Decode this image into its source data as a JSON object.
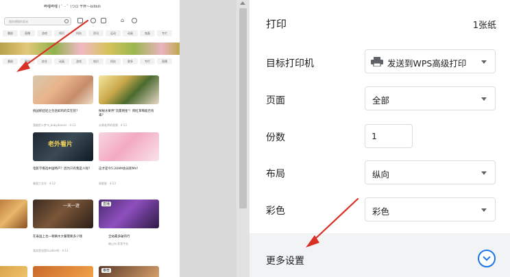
{
  "preview": {
    "page_header": "哔哩哔哩 ( ゜- ゜)つロ 干杯~-bilibili",
    "search_placeholder": "搜你想搜的发米",
    "tabs_row1": [
      "番剧",
      "直播",
      "游戏",
      "知识",
      "科技",
      "资讯",
      "运动",
      "动画",
      "鬼畜",
      "专栏",
      "创作中心"
    ],
    "tabs_row2": [
      "番剧",
      "国创",
      "综艺",
      "动画",
      "游戏",
      "知识",
      "科技",
      "更多",
      "专栏",
      "直播",
      "课堂",
      "新闻稿"
    ],
    "cards": [
      {
        "caption": "挑战抓娃娃之包括如鸡的实在装？",
        "author": "我能把人梦 b_babydancer · 4-13"
      },
      {
        "caption": "探秘水果界\"流量明星\"！网红草莓能否有毒？",
        "author": "水果老师的视频 · 4-13"
      },
      {
        "caption": "电影学看选中国特产？因为只有我是人呢？",
        "author": "美国工业学 · 4-12"
      },
      {
        "caption": "这才是今5:20AM会员新MV！",
        "author": "周星星 · 4-13"
      },
      {
        "caption": "在泰国上也一顿嘛水大餐需要多少钱",
        "author": "我卖是也是Gustler的 · 4-13"
      },
      {
        "caption": "全站最多破的行",
        "author": "暗山鸟·菲芙平台"
      }
    ],
    "card_badges": [
      "老外看片",
      "一天一遊",
      "直播",
      "推荐"
    ]
  },
  "panel": {
    "title": "打印",
    "sheet_count": "1张纸",
    "destination": {
      "label": "目标打印机",
      "value": "发送到WPS高级打印"
    },
    "pages": {
      "label": "页面",
      "value": "全部"
    },
    "copies": {
      "label": "份数",
      "value": "1"
    },
    "layout": {
      "label": "布局",
      "value": "纵向"
    },
    "color": {
      "label": "彩色",
      "value": "彩色"
    },
    "more_settings": "更多设置"
  },
  "icons": {
    "printer": "printer-icon",
    "expand": "chevron-down-circle-icon",
    "caret": "caret-down-icon"
  },
  "colors": {
    "accent": "#1a73e8",
    "annotation_arrow": "#d93025",
    "panel_bg": "#ffffff",
    "more_bg": "#f1f3f4"
  }
}
